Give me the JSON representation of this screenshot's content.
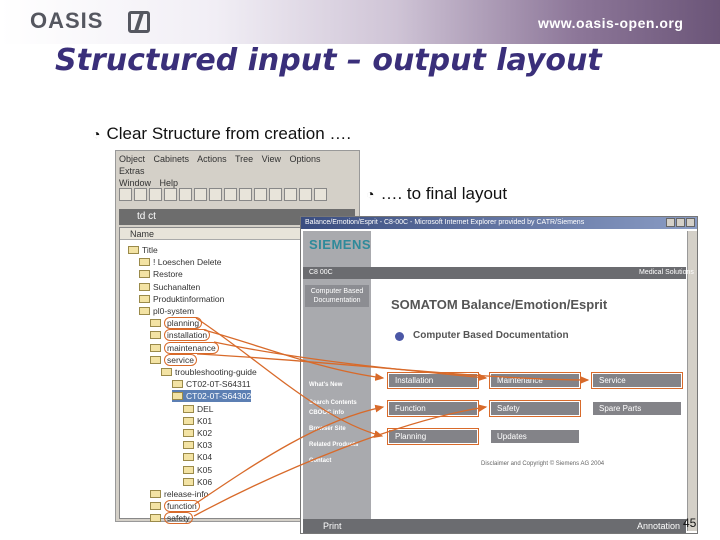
{
  "header": {
    "logo_text": "OASIS",
    "url": "www.oasis-open.org"
  },
  "slide": {
    "title": "Structured input – output layout",
    "bullets": [
      "Clear Structure from creation ….",
      "…. to final layout"
    ],
    "page_number": "45"
  },
  "explorer": {
    "menu": [
      "Object",
      "Cabinets",
      "Actions",
      "Tree",
      "View",
      "Options",
      "Extras",
      "Window",
      "Help"
    ],
    "tree_title": "td ct",
    "column_header": "Name",
    "tree_rows": [
      {
        "label": "Title",
        "indent": 0
      },
      {
        "label": "! Loeschen Delete",
        "indent": 1
      },
      {
        "label": "Restore",
        "indent": 1
      },
      {
        "label": "Suchanalten",
        "indent": 1
      },
      {
        "label": "Produktinformation",
        "indent": 1
      },
      {
        "label": "pl0-system",
        "indent": 1
      },
      {
        "label": "planning",
        "indent": 2
      },
      {
        "label": "installation",
        "indent": 2
      },
      {
        "label": "maintenance",
        "indent": 2
      },
      {
        "label": "service",
        "indent": 2
      },
      {
        "label": "troubleshooting-guide",
        "indent": 3
      },
      {
        "label": "CT02-0T-S64311",
        "indent": 4
      },
      {
        "label": "CT02-0T-S64302",
        "indent": 4
      },
      {
        "label": "DEL",
        "indent": 5
      },
      {
        "label": "K01",
        "indent": 5
      },
      {
        "label": "K02",
        "indent": 5
      },
      {
        "label": "K03",
        "indent": 5
      },
      {
        "label": "K04",
        "indent": 5
      },
      {
        "label": "K05",
        "indent": 5
      },
      {
        "label": "K06",
        "indent": 5
      },
      {
        "label": "release-info",
        "indent": 2
      },
      {
        "label": "function",
        "indent": 2
      },
      {
        "label": "safety",
        "indent": 2
      }
    ]
  },
  "browser": {
    "title": "Balance/Emotion/Esprit - C8-00C - Microsoft Internet Explorer provided by CATR/Siemens",
    "brand": "SIEMENS",
    "product_code": "C8 00C",
    "medical_solutions": "Medical Solutions",
    "cbd_link": "Computer Based Documentation",
    "product_title": "SOMATOM Balance/Emotion/Esprit",
    "section_title": "Computer Based Documentation",
    "side_links": [
      "What's New",
      "Search Contents",
      "CBOOC info",
      "Browser Site",
      "Related Products",
      "Contact"
    ],
    "buttons": [
      "Installation",
      "Maintenance",
      "Service",
      "Function",
      "Safety",
      "Spare Parts",
      "Planning",
      "Updates"
    ],
    "footer": "Disclaimer and Copyright © Siemens AG 2004",
    "print_label": "Print",
    "annotation_label": "Annotation"
  },
  "colors": {
    "title": "#3a2f7a",
    "highlight": "#d86a2a",
    "siemens": "#2f8a9a"
  }
}
